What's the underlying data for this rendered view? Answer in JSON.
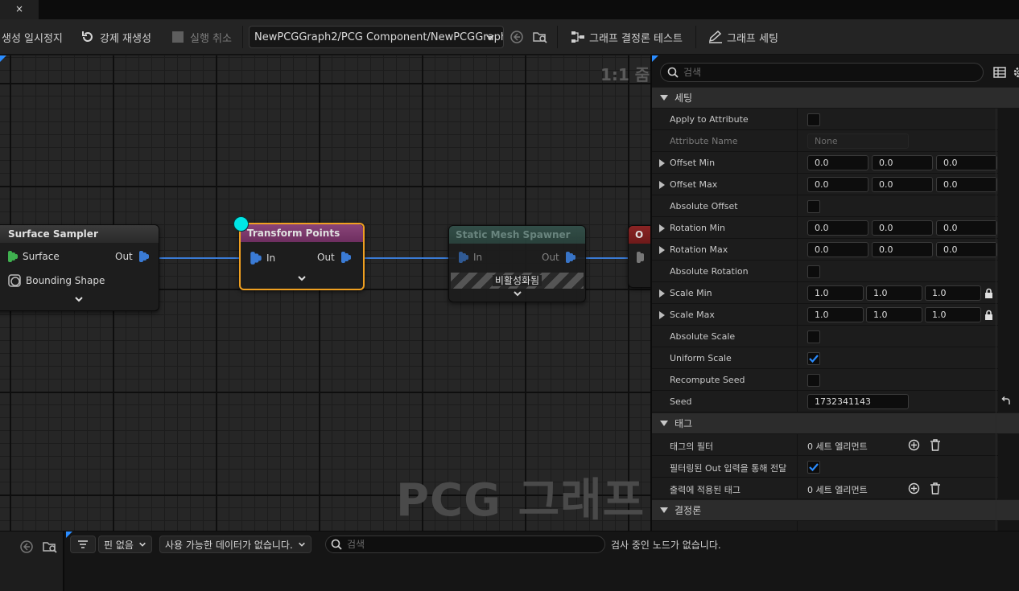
{
  "tab": {
    "close_glyph": "×"
  },
  "toolbar": {
    "pause_label": "생성 일시정지",
    "regenerate_label": "강제 재생성",
    "cancel_label": "실행 취소",
    "graph_path": "NewPCGGraph2/PCG Component/NewPCGGraph",
    "determinism_test_label": "그래프 결정론 테스트",
    "graph_settings_label": "그래프 세팅"
  },
  "graph": {
    "zoom_label": "1:1 줌",
    "watermark": "PCG 그래프",
    "nodes": {
      "surface_sampler": {
        "title": "Surface Sampler",
        "pin_surface": "Surface",
        "pin_out": "Out",
        "pin_bounding": "Bounding Shape"
      },
      "transform_points": {
        "title": "Transform Points",
        "pin_in": "In",
        "pin_out": "Out"
      },
      "static_mesh_spawner": {
        "title": "Static Mesh Spawner",
        "pin_in": "In",
        "pin_out": "Out",
        "disabled_label": "비활성화됨"
      },
      "partial_node": {
        "title": "O"
      }
    },
    "colors": {
      "wire": "#3a7bd5",
      "selection": "#f0a020",
      "transform_header": "#7b3a6e",
      "spawner_header": "#2f4a44",
      "partial_header": "#7a1e1e",
      "pin_green": "#3fb04f",
      "pin_blue": "#3a7bd5",
      "reroute": "#00e6e6"
    }
  },
  "details": {
    "search_placeholder": "검색",
    "sections": {
      "settings": "세팅",
      "tags": "태그",
      "determinism": "결정론"
    },
    "rows": {
      "apply_to_attribute": {
        "label": "Apply to Attribute",
        "checked": false
      },
      "attribute_name": {
        "label": "Attribute Name",
        "value": "None"
      },
      "offset_min": {
        "label": "Offset Min",
        "x": "0.0",
        "y": "0.0",
        "z": "0.0"
      },
      "offset_max": {
        "label": "Offset Max",
        "x": "0.0",
        "y": "0.0",
        "z": "0.0"
      },
      "absolute_offset": {
        "label": "Absolute Offset",
        "checked": false
      },
      "rotation_min": {
        "label": "Rotation Min",
        "x": "0.0",
        "y": "0.0",
        "z": "0.0"
      },
      "rotation_max": {
        "label": "Rotation Max",
        "x": "0.0",
        "y": "0.0",
        "z": "0.0"
      },
      "absolute_rotation": {
        "label": "Absolute Rotation",
        "checked": false
      },
      "scale_min": {
        "label": "Scale Min",
        "x": "1.0",
        "y": "1.0",
        "z": "1.0"
      },
      "scale_max": {
        "label": "Scale Max",
        "x": "1.0",
        "y": "1.0",
        "z": "1.0"
      },
      "absolute_scale": {
        "label": "Absolute Scale",
        "checked": false
      },
      "uniform_scale": {
        "label": "Uniform Scale",
        "checked": true
      },
      "recompute_seed": {
        "label": "Recompute Seed",
        "checked": false
      },
      "seed": {
        "label": "Seed",
        "value": "1732341143"
      },
      "tag_filter": {
        "label": "태그의 필터",
        "value": "0 세트 엘리먼트"
      },
      "pass_filtered_out": {
        "label": "필터링된 Out 입력을 통해 전달",
        "checked": true
      },
      "tags_applied": {
        "label": "출력에 적용된 태그",
        "value": "0 세트 엘리먼트"
      }
    },
    "colors": {
      "check": "#2a8cff"
    }
  },
  "bottom": {
    "pin_dropdown": "핀 없음",
    "data_dropdown": "사용 가능한 데이터가 없습니다.",
    "search_placeholder": "검색",
    "status": "검사 중인 노드가 없습니다."
  }
}
